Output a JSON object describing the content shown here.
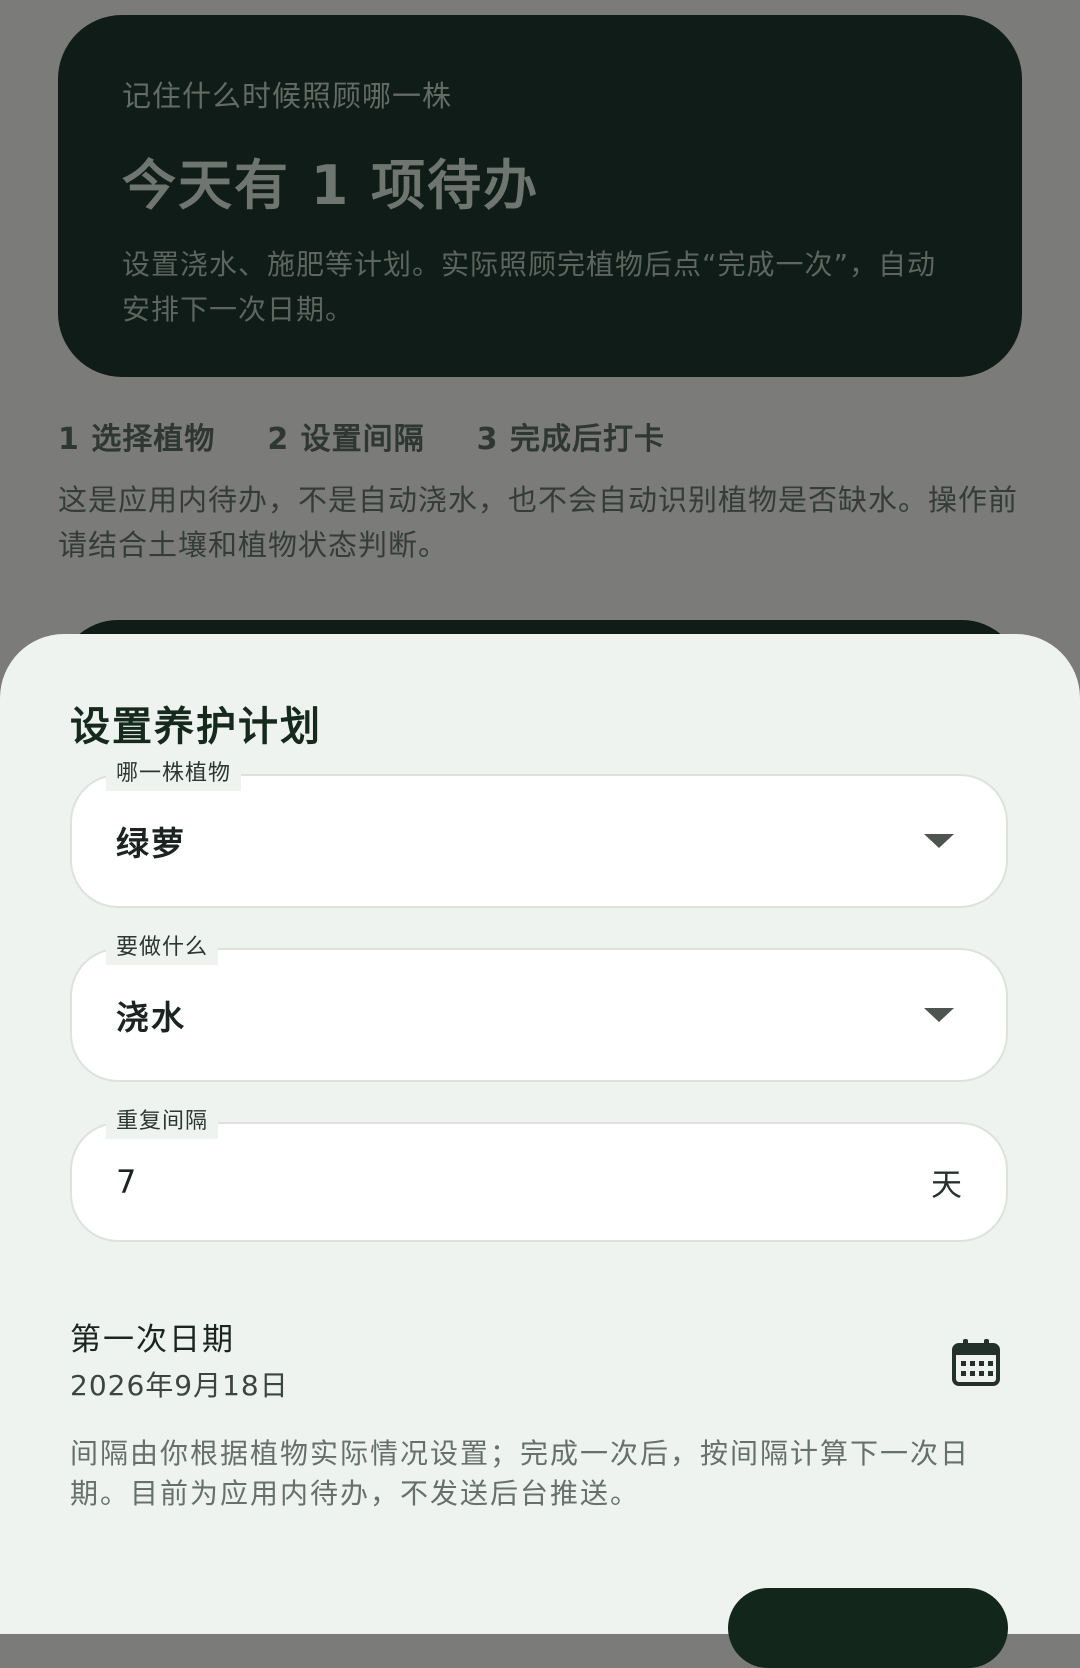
{
  "hero": {
    "eyebrow": "记住什么时候照顾哪一株",
    "title": "今天有 1 项待办",
    "description": "设置浇水、施肥等计划。实际照顾完植物后点“完成一次”，自动安排下一次日期。"
  },
  "steps": [
    {
      "label": "1 选择植物"
    },
    {
      "label": "2 设置间隔"
    },
    {
      "label": "3 完成后打卡"
    }
  ],
  "notice": "这是应用内待办，不是自动浇水，也不会自动识别植物是否缺水。操作前请结合土壤和植物状态判断。",
  "sheet": {
    "title": "设置养护计划",
    "plant_field": {
      "label": "哪一株植物",
      "value": "绿萝"
    },
    "task_field": {
      "label": "要做什么",
      "value": "浇水"
    },
    "interval_field": {
      "label": "重复间隔",
      "value": "7",
      "suffix": "天"
    },
    "first_date": {
      "label": "第一次日期",
      "value": "2026年9月18日",
      "icon": "calendar-icon"
    },
    "help_text": "间隔由你根据植物实际情况设置；完成一次后，按间隔计算下一次日期。目前为应用内待办，不发送后台推送。"
  },
  "colors": {
    "dark_green": "#0f1c17",
    "sheet_bg": "#eff3ef",
    "scrim": "#7b7b79"
  }
}
